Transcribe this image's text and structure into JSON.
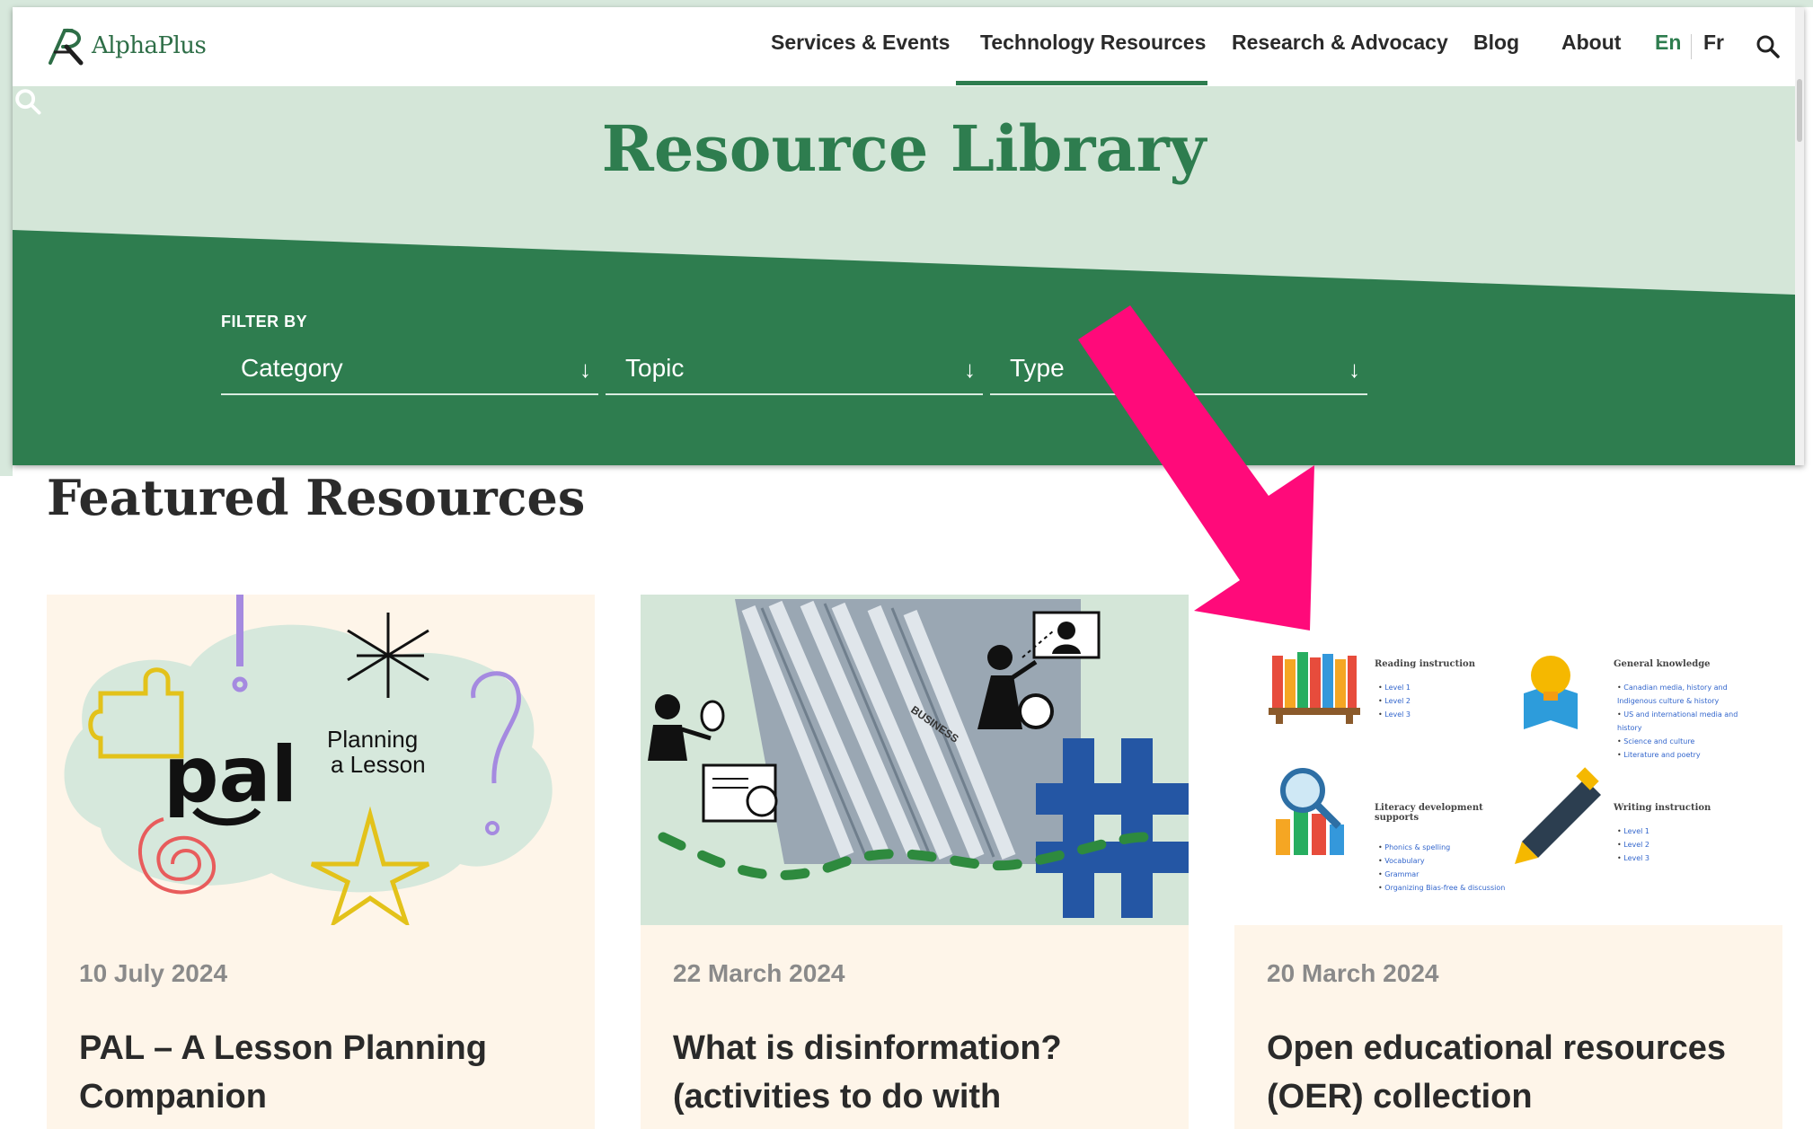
{
  "brand": {
    "logo_text": "AlphaPlus"
  },
  "nav": {
    "items": [
      "Services & Events",
      "Technology Resources",
      "Research & Advocacy",
      "Blog",
      "About"
    ],
    "active": "Technology Resources",
    "lang_en": "En",
    "lang_fr": "Fr"
  },
  "hero": {
    "title": "Resource Library"
  },
  "filters": {
    "label": "FILTER BY",
    "category": "Category",
    "topic": "Topic",
    "type": "Type"
  },
  "featured": {
    "title": "Featured Resources",
    "cards": [
      {
        "date": "10 July 2024",
        "title": "PAL – A Lesson Planning Companion",
        "image_text_1": "pal",
        "image_text_2": "Planning",
        "image_text_3": "a Lesson"
      },
      {
        "date": "22 March 2024",
        "title": "What is disinformation? (activities to do with",
        "image_text": "BUSINESS"
      },
      {
        "date": "20 March 2024",
        "title": "Open educational resources (OER) collection",
        "oer_sections": [
          {
            "heading": "Reading instruction",
            "items": [
              "Level 1",
              "Level 2",
              "Level 3"
            ]
          },
          {
            "heading": "General knowledge",
            "items": [
              "Canadian media, history and Indigenous culture & history",
              "US and international media and history",
              "Science and culture",
              "Literature and poetry"
            ]
          },
          {
            "heading": "Literacy development supports",
            "items": [
              "Phonics & spelling",
              "Vocabulary",
              "Grammar",
              "Organizing Bias-free & discussion"
            ]
          },
          {
            "heading": "Writing instruction",
            "items": [
              "Level 1",
              "Level 2",
              "Level 3"
            ]
          }
        ]
      }
    ]
  },
  "colors": {
    "brand_green": "#2e7d4f",
    "hero_light": "#d4e6d8",
    "card_bg": "#fef5e9",
    "highlight_arrow": "#ff0a7a"
  }
}
